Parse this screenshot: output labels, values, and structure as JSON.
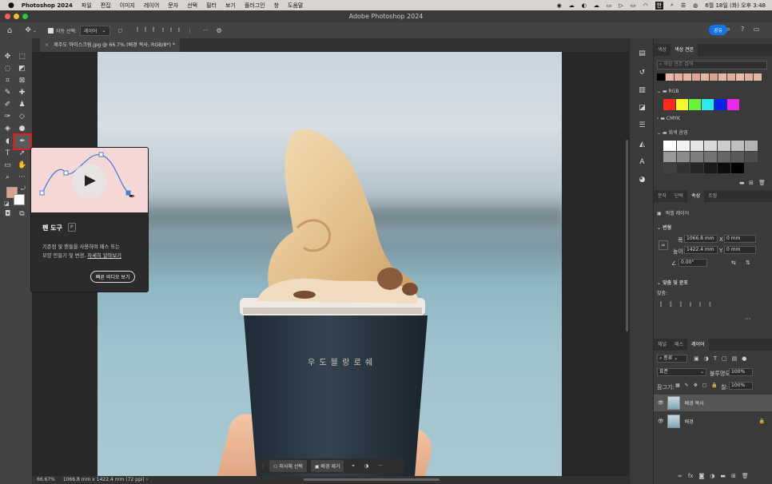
{
  "menubar": {
    "app_name": "Photoshop 2024",
    "items": [
      "파일",
      "편집",
      "이미지",
      "레이어",
      "문자",
      "선택",
      "필터",
      "보기",
      "플러그인",
      "창",
      "도움말"
    ],
    "clock": "6월 18일 (화) 오후 3:48",
    "input_method": "한"
  },
  "window": {
    "title": "Adobe Photoshop 2024"
  },
  "optionsbar": {
    "auto_select_label": "자동 선택:",
    "auto_select_value": "레이어",
    "share_label": "공유"
  },
  "document_tab": {
    "label": "제주도 아이스크림.jpg @ 66.7% (배경 복사, RGB/8*) *"
  },
  "statusbar": {
    "zoom": "66.67%",
    "info": "1066.8 mm x 1422.4 mm (72 ppi)"
  },
  "tooltip": {
    "title": "펜 도구",
    "shortcut": "P",
    "desc_line1": "기준점 및 핸들을 사용하여 패스 또는",
    "desc_line2": "모양 만들기 및 변경.",
    "learn_more": "자세히 알아보기",
    "video_button": "빠른 비디오 보기"
  },
  "cup_text": "우 도 블 랑 로 쉐",
  "context_bar": {
    "select_subject": "피사체 선택",
    "remove_bg": "배경 제거",
    "more": "···"
  },
  "swatches_panel": {
    "tabs": [
      "색상",
      "색상 견본"
    ],
    "search_placeholder": "색상 견본 검색",
    "groups": [
      "RGB",
      "CMYK",
      "회색 음영"
    ]
  },
  "properties_panel": {
    "tabs": [
      "문자",
      "단락",
      "속성",
      "조정"
    ],
    "layer_type": "픽셀 레이어",
    "transform_header": "변형",
    "width_label": "폭",
    "width_value": "1066.8 mm",
    "height_label": "높이",
    "height_value": "1422.4 mm",
    "x_label": "X",
    "x_value": "0 mm",
    "y_label": "Y",
    "y_value": "0 mm",
    "angle_value": "0.00°",
    "align_header": "맞춤 및 분포",
    "align_label": "맞춤:",
    "more": "···"
  },
  "layers_panel": {
    "tabs": [
      "채널",
      "패스",
      "레이어"
    ],
    "filter_label": "종류",
    "blend_mode": "표준",
    "opacity_label": "불투명도:",
    "opacity_value": "100%",
    "lock_label": "잠그기:",
    "fill_label": "칠:",
    "fill_value": "100%",
    "layers": [
      {
        "name": "배경 복사"
      },
      {
        "name": "배경"
      }
    ]
  },
  "colors": {
    "foreground": "#d9a48f",
    "background": "#ffffff",
    "accent": "#1473e6",
    "rgb_swatches": [
      "#ff2a1f",
      "#f8f82a",
      "#6af23a",
      "#2ee8f0",
      "#0a22e8",
      "#e82ae8"
    ],
    "recent_swatches": [
      "#000000",
      "#e8b8a8",
      "#e6b19f",
      "#e8b5a5",
      "#dca595",
      "#e3b7a6",
      "#d9a48f",
      "#e5b9a8",
      "#dfad9b",
      "#e8bfae",
      "#e0b2a0",
      "#e6b6a4"
    ],
    "gray_swatches": [
      "#ffffff",
      "#f2f2f2",
      "#e6e6e6",
      "#d9d9d9",
      "#cccccc",
      "#bfbfbf",
      "#b3b3b3",
      "#999999",
      "#8c8c8c",
      "#7f7f7f",
      "#737373",
      "#666666",
      "#595959",
      "#4d4d4d",
      "#404040",
      "#333333",
      "#262626",
      "#1a1a1a",
      "#0d0d0d",
      "#000000"
    ]
  }
}
